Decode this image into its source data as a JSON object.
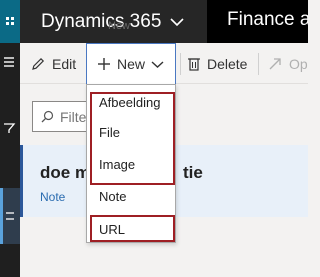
{
  "topbar": {
    "app_name": "Dynamics 365",
    "module": "Finance and",
    "ghost_label": "New"
  },
  "actions": {
    "edit": "Edit",
    "new": "New",
    "delete": "Delete",
    "open": "Op"
  },
  "filter": {
    "placeholder": "Filte"
  },
  "card": {
    "title": "doe m",
    "title_tail": "tie",
    "type": "Note"
  },
  "menu": {
    "items": [
      "Afbeelding",
      "File",
      "Image",
      "Note",
      "URL"
    ]
  },
  "colors": {
    "waffle": "#0b6a86",
    "highlight": "#9e1f24",
    "accent": "#2b6cb0"
  }
}
